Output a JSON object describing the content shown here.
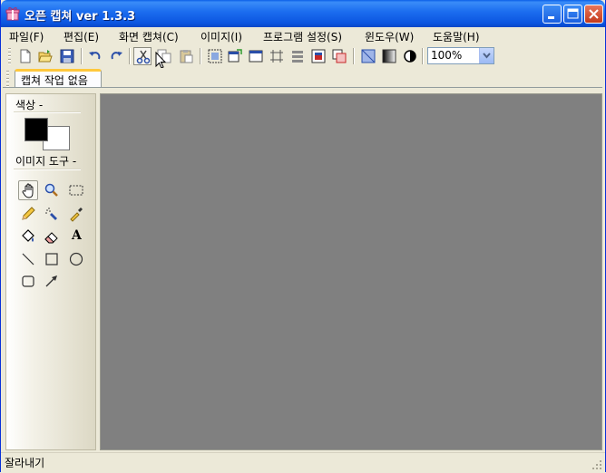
{
  "window": {
    "title": "오픈 캡쳐 ver 1.3.3",
    "controls": [
      "minimize",
      "maximize",
      "close"
    ]
  },
  "menu": [
    {
      "label": "파일(F)"
    },
    {
      "label": "편집(E)"
    },
    {
      "label": "화면 캡쳐(C)"
    },
    {
      "label": "이미지(I)"
    },
    {
      "label": "프로그램 설정(S)"
    },
    {
      "label": "윈도우(W)"
    },
    {
      "label": "도움말(H)"
    }
  ],
  "toolbar": {
    "zoom_value": "100%"
  },
  "tabs": [
    {
      "label": "캡쳐 작업 없음",
      "active": true
    }
  ],
  "left_panel": {
    "color_label": "색상 -",
    "foreground_color": "#000000",
    "background_color": "#ffffff",
    "tools_label": "이미지 도구 -",
    "text_tool_glyph": "A"
  },
  "status": {
    "text": "잘라내기"
  },
  "colors": {
    "canvas": "#808080",
    "titlebar": "#0b55e0",
    "chrome": "#ece9d8"
  }
}
